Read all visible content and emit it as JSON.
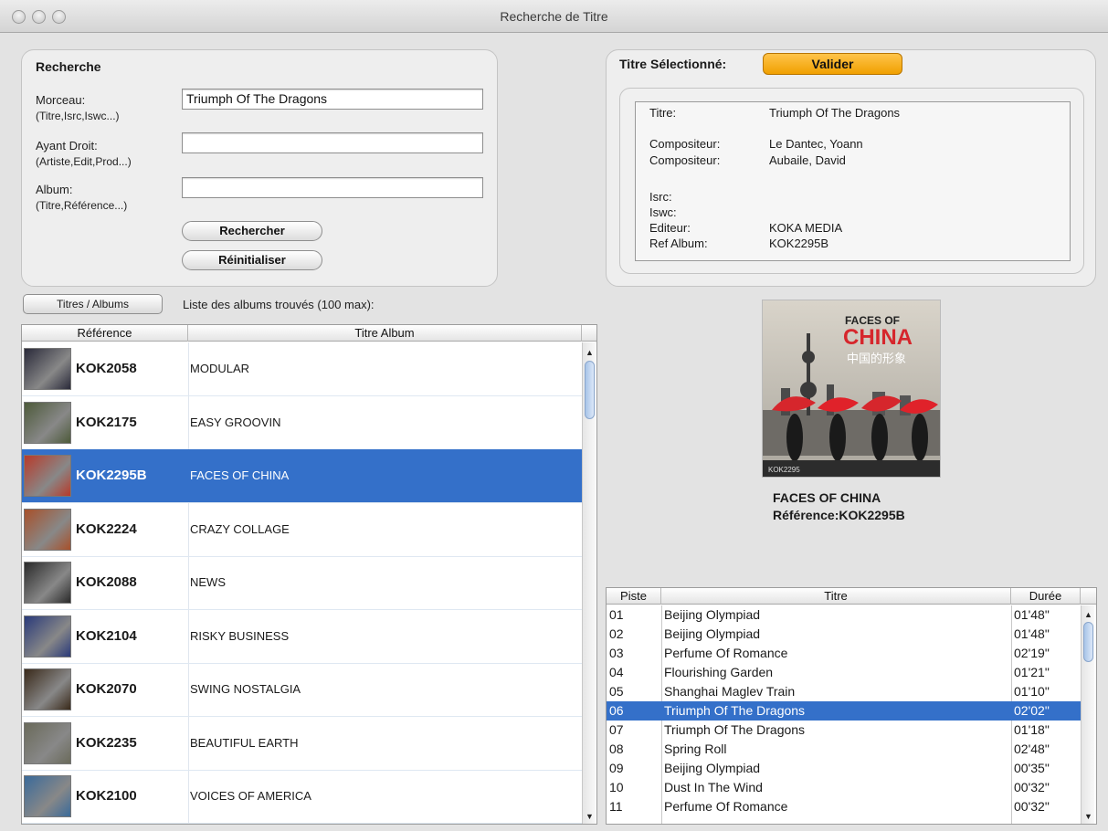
{
  "window": {
    "title": "Recherche de Titre"
  },
  "search": {
    "heading": "Recherche",
    "morceau_label": "Morceau:",
    "morceau_hint": "(Titre,Isrc,Iswc...)",
    "morceau_value": "Triumph Of The Dragons",
    "ayant_label": "Ayant Droit:",
    "ayant_hint": "(Artiste,Edit,Prod...)",
    "ayant_value": "",
    "album_label": "Album:",
    "album_hint": "(Titre,Référence...)",
    "album_value": "",
    "search_button": "Rechercher",
    "reset_button": "Réinitialiser"
  },
  "selected": {
    "heading": "Titre Sélectionné:",
    "validate_button": "Valider",
    "details": [
      {
        "key": "Titre:",
        "value": "Triumph Of The Dragons"
      },
      {
        "key": "Compositeur:",
        "value": "Le Dantec, Yoann"
      },
      {
        "key": "Compositeur:",
        "value": "Aubaile, David"
      },
      {
        "key": "Isrc:",
        "value": ""
      },
      {
        "key": "Iswc:",
        "value": ""
      },
      {
        "key": "Editeur:",
        "value": "KOKA MEDIA"
      },
      {
        "key": "Ref Album:",
        "value": "KOK2295B"
      }
    ]
  },
  "albums": {
    "toggle_button": "Titres / Albums",
    "list_caption": "Liste des albums trouvés (100 max):",
    "columns": [
      "Référence",
      "Titre Album"
    ],
    "rows": [
      {
        "ref": "KOK2058",
        "title": "MODULAR",
        "thumb_color": "#2a2a3a"
      },
      {
        "ref": "KOK2175",
        "title": "EASY GROOVIN",
        "thumb_color": "#4d5a3a"
      },
      {
        "ref": "KOK2295B",
        "title": "FACES OF CHINA",
        "thumb_color": "#b83a2a"
      },
      {
        "ref": "KOK2224",
        "title": "CRAZY COLLAGE",
        "thumb_color": "#a8502a"
      },
      {
        "ref": "KOK2088",
        "title": "NEWS",
        "thumb_color": "#2a2a2a"
      },
      {
        "ref": "KOK2104",
        "title": "RISKY BUSINESS",
        "thumb_color": "#2a3a7a"
      },
      {
        "ref": "KOK2070",
        "title": "SWING NOSTALGIA",
        "thumb_color": "#3a2a1a"
      },
      {
        "ref": "KOK2235",
        "title": "BEAUTIFUL EARTH",
        "thumb_color": "#6a6a5a"
      },
      {
        "ref": "KOK2100",
        "title": "VOICES OF AMERICA",
        "thumb_color": "#3a6a9a"
      }
    ],
    "selected_index": 2
  },
  "cover": {
    "title_line1": "FACES OF",
    "title_line2": "CHINA",
    "chinese": "中国的形象",
    "code": "KOK2295"
  },
  "album_caption": {
    "name": "FACES OF CHINA",
    "reference": "Référence:KOK2295B"
  },
  "tracks": {
    "columns": [
      "Piste",
      "Titre",
      "Durée"
    ],
    "rows": [
      {
        "n": "01",
        "title": "Beijing Olympiad",
        "dur": "01'48\""
      },
      {
        "n": "02",
        "title": "Beijing Olympiad",
        "dur": "01'48\""
      },
      {
        "n": "03",
        "title": "Perfume Of Romance",
        "dur": "02'19\""
      },
      {
        "n": "04",
        "title": "Flourishing Garden",
        "dur": "01'21\""
      },
      {
        "n": "05",
        "title": "Shanghai Maglev Train",
        "dur": "01'10\""
      },
      {
        "n": "06",
        "title": "Triumph Of The Dragons",
        "dur": "02'02\""
      },
      {
        "n": "07",
        "title": "Triumph Of The Dragons",
        "dur": "01'18\""
      },
      {
        "n": "08",
        "title": "Spring Roll",
        "dur": "02'48\""
      },
      {
        "n": "09",
        "title": "Beijing Olympiad",
        "dur": "00'35\""
      },
      {
        "n": "10",
        "title": "Dust In The Wind",
        "dur": "00'32\""
      },
      {
        "n": "11",
        "title": "Perfume Of Romance",
        "dur": "00'32\""
      }
    ],
    "selected_index": 5
  }
}
